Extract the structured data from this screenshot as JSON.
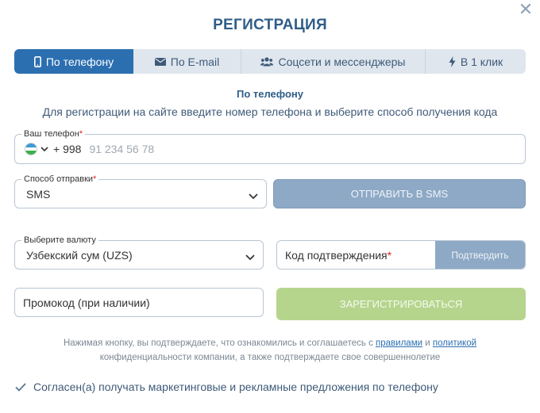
{
  "header": {
    "title": "РЕГИСТРАЦИЯ"
  },
  "tabs": [
    {
      "label": "По телефону",
      "icon": "phone-icon",
      "active": true
    },
    {
      "label": "По E-mail",
      "icon": "envelope-icon",
      "active": false
    },
    {
      "label": "Соцсети и мессенджеры",
      "icon": "users-icon",
      "active": false
    },
    {
      "label": "В 1 клик",
      "icon": "lightning-icon",
      "active": false
    }
  ],
  "section": {
    "title": "По телефону",
    "description": "Для регистрации на сайте введите номер телефона и выберите способ получения кода"
  },
  "phone": {
    "label": "Ваш телефон",
    "required_mark": "*",
    "country_code": "+ 998",
    "placeholder": "91 234 56 78"
  },
  "send_method": {
    "label": "Способ отправки",
    "required_mark": "*",
    "value": "SMS",
    "button_label": "ОТПРАВИТЬ В SMS"
  },
  "currency": {
    "label": "Выберите валюту",
    "value": "Узбекский сум (UZS)"
  },
  "confirmation": {
    "label": "Код подтверждения",
    "required_mark": "*",
    "button_label": "Подтвердить"
  },
  "promo": {
    "placeholder": "Промокод (при наличии)"
  },
  "register": {
    "button_label": "ЗАРЕГИСТРИРОВАТЬСЯ"
  },
  "legal": {
    "text_1": "Нажимая кнопку, вы подтверждаете, что ознакомились и соглашаетесь с ",
    "link_rules": "правилами",
    "text_2": " и ",
    "link_policy": "политикой",
    "text_3": "конфиденциальности компании, а также подтверждаете свое совершеннолетие"
  },
  "consent": {
    "label": "Согласен(а) получать маркетинговые и рекламные предложения по телефону",
    "checked": true
  },
  "colors": {
    "primary": "#2c6fb1",
    "title": "#2f5d88",
    "disabled_button": "#8ea9c6",
    "register_button": "#b5d58d",
    "required": "#e02020"
  }
}
